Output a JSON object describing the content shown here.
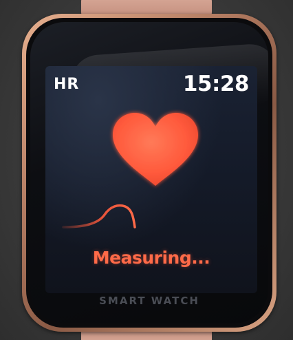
{
  "watch": {
    "screen": {
      "title": "HR",
      "time": "15:28",
      "status": "Measuring..."
    },
    "brand_text": "SMART WATCH",
    "icons": {
      "heart": "heart-icon",
      "pulse": "pulse-wave-icon"
    },
    "colors": {
      "accent": "#ff6a48",
      "heart": "#ff5a3c",
      "display_bg": "#141a28"
    }
  }
}
